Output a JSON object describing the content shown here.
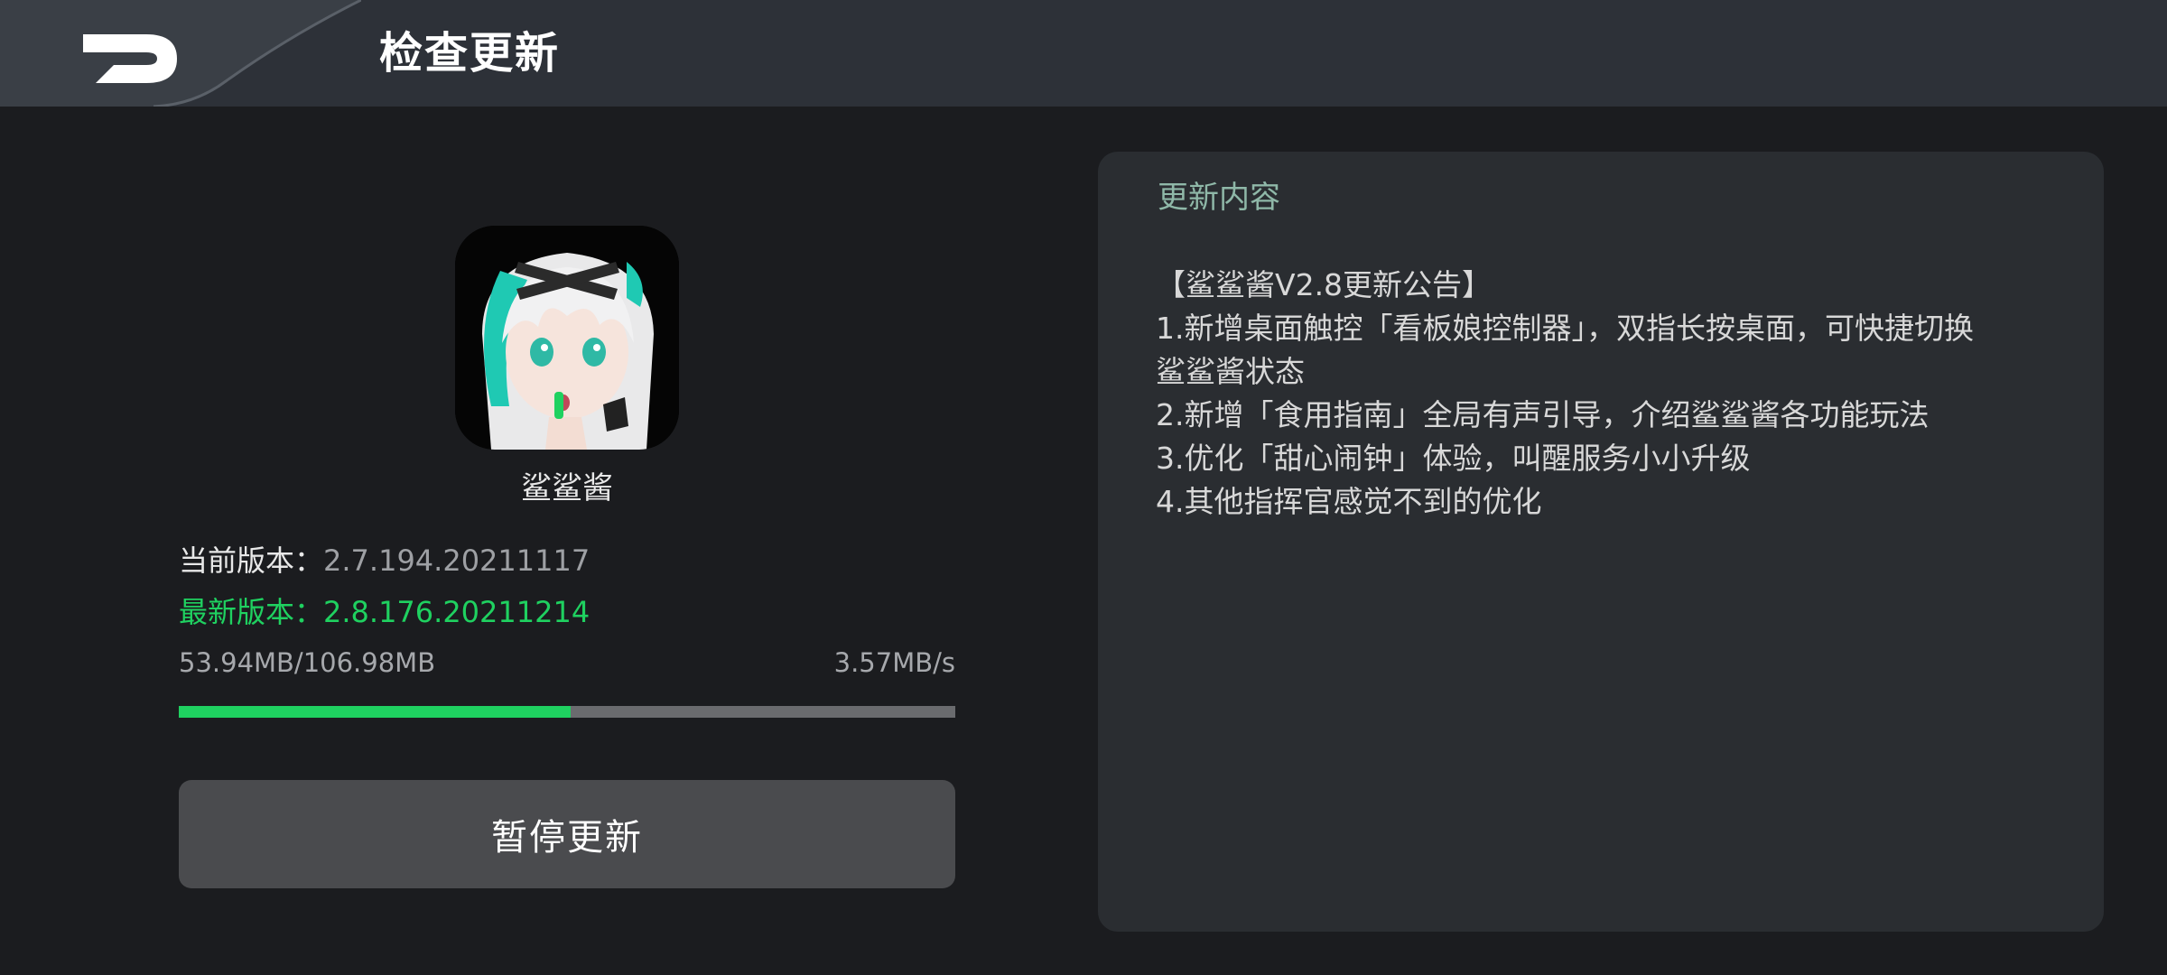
{
  "header": {
    "title": "检查更新",
    "back_icon": "back-arrow-icon"
  },
  "app": {
    "name": "鲨鲨酱",
    "icon": "anime-character-app-icon"
  },
  "versions": {
    "current_label": "当前版本：",
    "current_value": "2.7.194.20211117",
    "latest_text": "最新版本：2.8.176.20211214"
  },
  "download": {
    "progress_text": "53.94MB/106.98MB",
    "speed": "3.57MB/s",
    "progress_fraction": 0.5042
  },
  "pause_button": {
    "label": "暂停更新"
  },
  "notes": {
    "title": "更新内容",
    "lines": [
      "【鲨鲨酱V2.8更新公告】",
      "1.新增桌面触控「看板娘控制器」，双指长按桌面，可快捷切换",
      "鲨鲨酱状态",
      "2.新增「食用指南」全局有声引导，介绍鲨鲨酱各功能玩法",
      "3.优化「甜心闹钟」体验，叫醒服务小小升级",
      "4.其他指挥官感觉不到的优化"
    ]
  },
  "colors": {
    "accent_green": "#1fd160",
    "header_bg": "#2d3138",
    "page_bg": "#1b1c1f",
    "panel_bg": "#2a2d31",
    "button_bg": "#4a4b4e",
    "notes_title": "#8fb8a8"
  }
}
